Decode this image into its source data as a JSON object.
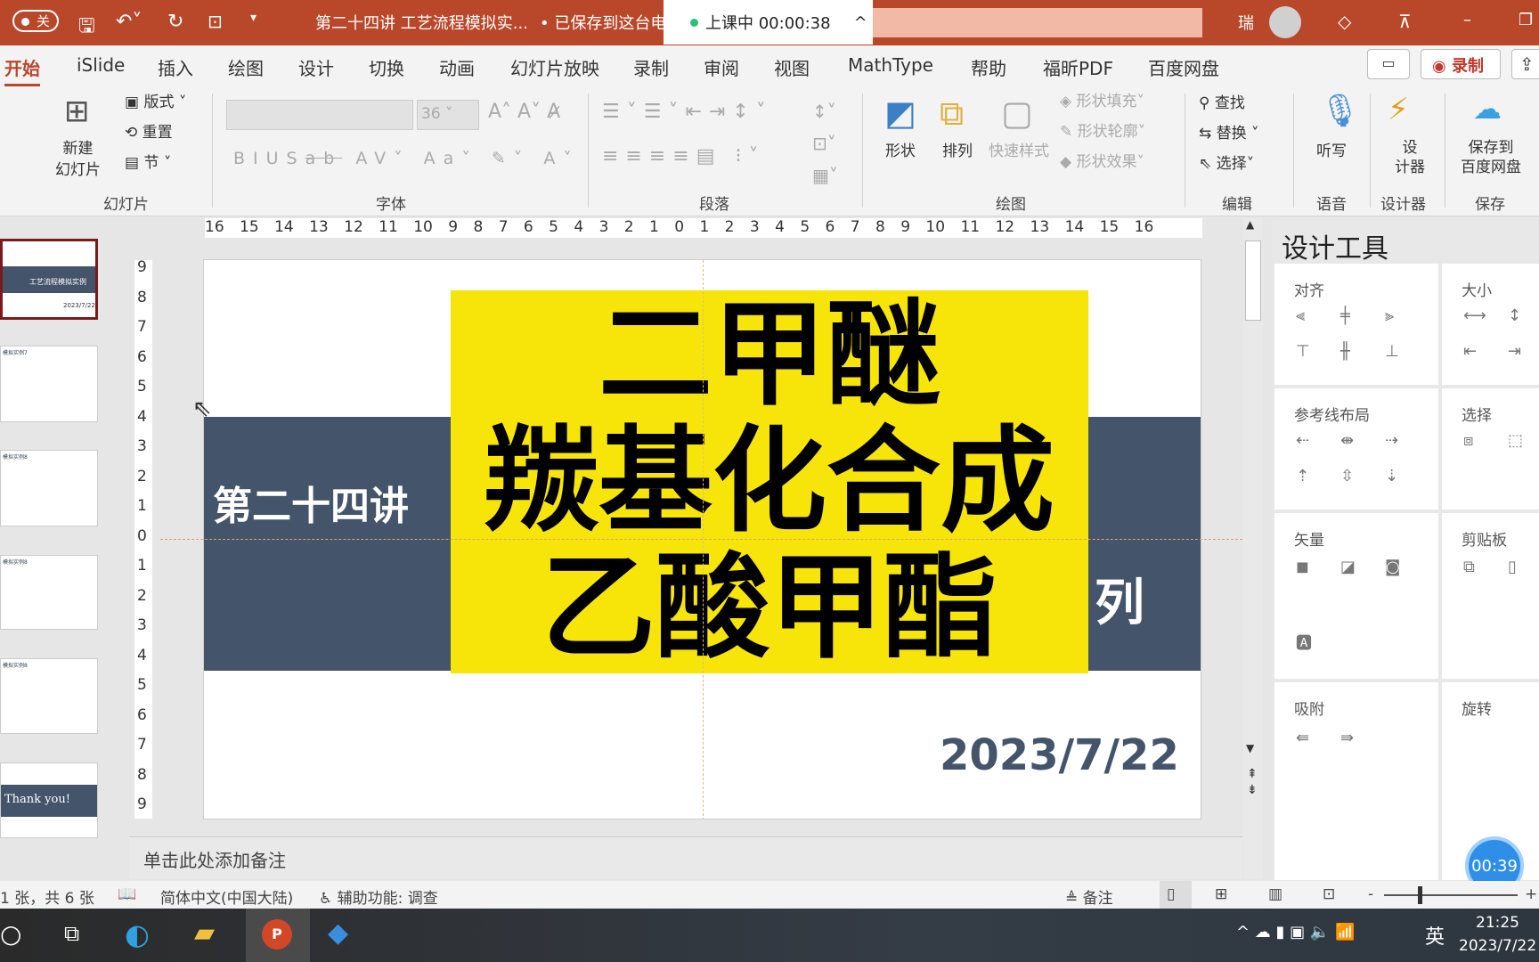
{
  "titlebar": {
    "autosave_label": "关",
    "doc_title": "第二十四讲 工艺流程模拟实...",
    "save_status": "• 已保存到这台电",
    "user_initial": "瑞",
    "lecture_status": "上课中 00:00:38"
  },
  "tabs": [
    "开始",
    "iSlide",
    "插入",
    "绘图",
    "设计",
    "切换",
    "动画",
    "幻灯片放映",
    "录制",
    "审阅",
    "视图",
    "MathType",
    "帮助",
    "福昕PDF",
    "百度网盘"
  ],
  "record_button": "录制",
  "ribbon": {
    "slides": {
      "new_slide": "新建\n幻灯片",
      "layout": "版式",
      "reset": "重置",
      "section": "节",
      "label": "幻灯片"
    },
    "font": {
      "font_name": "",
      "font_size": "36",
      "label": "字体"
    },
    "paragraph": {
      "label": "段落"
    },
    "drawing": {
      "shapes": "形状",
      "arrange": "排列",
      "quick_styles": "快速样式",
      "shape_fill": "形状填充",
      "shape_outline": "形状轮廓",
      "shape_effects": "形状效果",
      "label": "绘图"
    },
    "editing": {
      "find": "查找",
      "replace": "替换",
      "select": "选择",
      "label": "编辑"
    },
    "voice": {
      "dictate": "听写",
      "label": "语音"
    },
    "designer": {
      "designer": "设\n计器",
      "label": "设计器"
    },
    "save": {
      "save_baidu": "保存到\n百度网盘",
      "label": "保存"
    }
  },
  "hruler": "16 15 14 13 12 11 10 9 8 7 6 5 4 3 2 1 0 1 2 3 4 5 6 7 8 9 10 11 12 13 14 15 16",
  "vruler": [
    "9",
    "8",
    "7",
    "6",
    "5",
    "4",
    "3",
    "2",
    "1",
    "0",
    "1",
    "2",
    "3",
    "4",
    "5",
    "6",
    "7",
    "8",
    "9"
  ],
  "thumbnails": [
    {
      "title": "工艺流程模拟实例",
      "date": "2023/7/22"
    },
    {
      "title": "模拟实例7"
    },
    {
      "title": "模拟实例8"
    },
    {
      "title": "模拟实例8"
    },
    {
      "title": "模拟实例8"
    },
    {
      "title": "Thank you!"
    }
  ],
  "slide": {
    "lecture": "第二十四讲",
    "title_lines": [
      "二甲醚",
      "羰基化合成",
      "乙酸甲酯"
    ],
    "partial_text": "列",
    "date": "2023/7/22",
    "band_color": "#44546a",
    "highlight_color": "#f7e50a"
  },
  "notes_placeholder": "单击此处添加备注",
  "design_pane": {
    "title": "设计工具",
    "sections": [
      "对齐",
      "大小",
      "参考线布局",
      "选择",
      "矢量",
      "剪贴板",
      "吸附",
      "旋转"
    ]
  },
  "timer": "00:39",
  "status": {
    "slide_count": "1 张，共 6 张",
    "language": "简体中文(中国大陆)",
    "accessibility": "辅助功能: 调查",
    "notes": "备注"
  },
  "taskbar": {
    "time": "21:25",
    "date": "2023/7/22",
    "ime": "英"
  }
}
